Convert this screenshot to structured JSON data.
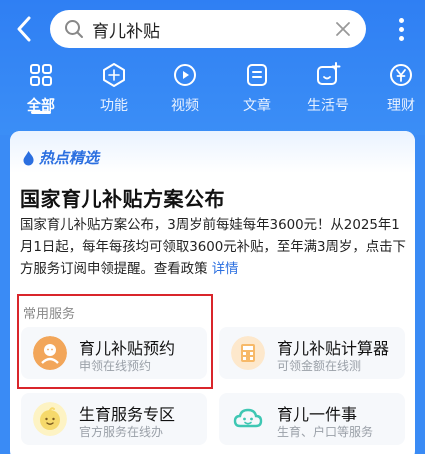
{
  "search": {
    "value": "育儿补贴"
  },
  "tabs": [
    {
      "label": "全部",
      "icon": "grid-icon",
      "active": true
    },
    {
      "label": "功能",
      "icon": "cube-icon"
    },
    {
      "label": "视频",
      "icon": "play-icon"
    },
    {
      "label": "文章",
      "icon": "document-icon"
    },
    {
      "label": "生活号",
      "icon": "plus-chat-icon"
    },
    {
      "label": "理财",
      "icon": "yen-icon"
    }
  ],
  "card": {
    "tag": "热点精选",
    "title": "国家育儿补贴方案公布",
    "body": "国家育儿补贴方案公布，3周岁前每娃每年3600元！从2025年1月1日起，每年每孩均可领取3600元补贴，至年满3周岁，点击下方服务订阅申领提醒。查看政策",
    "detail_link": "详情",
    "section_label": "常用服务"
  },
  "services": [
    {
      "title": "育儿补贴预约",
      "subtitle": "申领在线预约",
      "icon": "baby-icon",
      "color": "#f2a65a"
    },
    {
      "title": "育儿补贴计算器",
      "subtitle": "可领金额在线测",
      "icon": "calculator-icon",
      "color": "#f7b968"
    },
    {
      "title": "生育服务专区",
      "subtitle": "官方服务在线办",
      "icon": "baby-face-icon",
      "color": "#f6d96b"
    },
    {
      "title": "育儿一件事",
      "subtitle": "生育、户口等服务",
      "icon": "cloud-smile-icon",
      "color": "#3ec7b3"
    }
  ],
  "colors": {
    "brand_blue": "#2f7ff3",
    "highlight_red": "#d9252b"
  }
}
